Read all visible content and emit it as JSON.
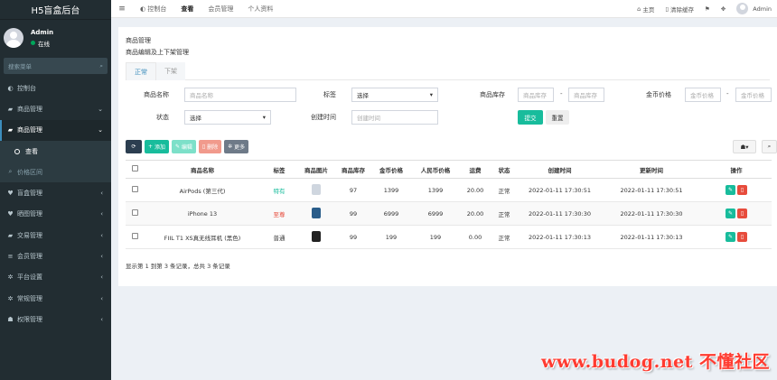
{
  "sidebar": {
    "brand": "H5盲盒后台",
    "user_name": "Admin",
    "user_status": "在线",
    "search_placeholder": "搜索菜单",
    "items": [
      {
        "icon": "dashboard-icon",
        "glyph": "◐",
        "label": "控制台",
        "arrow": ""
      },
      {
        "icon": "bag-icon",
        "glyph": "▰",
        "label": "商品管理",
        "arrow": "⌄"
      },
      {
        "icon": "bag-icon",
        "glyph": "▰",
        "label": "商品管理",
        "arrow": "⌄"
      },
      {
        "icon": "circle-icon",
        "glyph": "",
        "label": "查看",
        "arrow": ""
      },
      {
        "icon": "search-icon",
        "glyph": "⌕",
        "label": "价格区间",
        "arrow": ""
      },
      {
        "icon": "box-icon",
        "glyph": "♥",
        "label": "盲盒管理",
        "arrow": "‹"
      },
      {
        "icon": "box-icon",
        "glyph": "♥",
        "label": "晒图管理",
        "arrow": "‹"
      },
      {
        "icon": "trade-icon",
        "glyph": "▰",
        "label": "交易管理",
        "arrow": "‹"
      },
      {
        "icon": "member-icon",
        "glyph": "≡",
        "label": "会员管理",
        "arrow": "‹"
      },
      {
        "icon": "gears-icon",
        "glyph": "✲",
        "label": "平台设置",
        "arrow": "‹"
      },
      {
        "icon": "gears-icon",
        "glyph": "✲",
        "label": "常规管理",
        "arrow": "‹"
      },
      {
        "icon": "users-icon",
        "glyph": "☗",
        "label": "权限管理",
        "arrow": "‹"
      }
    ]
  },
  "topbar": {
    "tabs": [
      "控制台",
      "查看",
      "会员管理",
      "个人资料"
    ],
    "home": "主页",
    "clear_cache": "清除缓存",
    "user": "Admin"
  },
  "panel": {
    "title": "商品管理",
    "subtitle": "商品编辑及上下架管理",
    "tabs": [
      "正常",
      "下架"
    ]
  },
  "filter": {
    "name_label": "商品名称",
    "name_placeholder": "商品名称",
    "tag_label": "标签",
    "tag_value": "选择",
    "stock_label": "商品库存",
    "stock_placeholder": "商品库存",
    "coin_label": "金币价格",
    "coin_placeholder": "金币价格",
    "status_label": "状态",
    "status_value": "选择",
    "time_label": "创建时间",
    "time_placeholder": "创建时间",
    "submit": "提交",
    "reset": "重置",
    "dash": "-"
  },
  "toolbar": {
    "add": "添加",
    "edit": "编辑",
    "delete": "删除",
    "more": "更多"
  },
  "table": {
    "headers": [
      "商品名称",
      "标签",
      "商品图片",
      "商品库存",
      "金币价格",
      "人民币价格",
      "运费",
      "状态",
      "创建时间",
      "更新时间",
      "操作"
    ],
    "rows": [
      {
        "name": "AirPods (第三代)",
        "tag": "特有",
        "tag_class": "tag-hot",
        "thumb": "#cfd6df",
        "stock": "97",
        "coin": "1399",
        "rmb": "1399",
        "freight": "20.00",
        "status": "正常",
        "created": "2022-01-11 17:30:51",
        "updated": "2022-01-11 17:30:51"
      },
      {
        "name": "iPhone 13",
        "tag": "至尊",
        "tag_class": "tag-rare",
        "thumb": "#2a5d8a",
        "stock": "99",
        "coin": "6999",
        "rmb": "6999",
        "freight": "20.00",
        "status": "正常",
        "created": "2022-01-11 17:30:30",
        "updated": "2022-01-11 17:30:30"
      },
      {
        "name": "FIIL T1 XS真无线耳机 (黑色)",
        "tag": "普通",
        "tag_class": "tag-norm",
        "thumb": "#222222",
        "stock": "99",
        "coin": "199",
        "rmb": "199",
        "freight": "0.00",
        "status": "正常",
        "created": "2022-01-11 17:30:13",
        "updated": "2022-01-11 17:30:13"
      }
    ]
  },
  "summary": "显示第 1 到第 3 条记录，总共 3 条记录",
  "watermark": "www.budog.net 不懂社区",
  "colors": {
    "accent": "#18bc9c",
    "sidebar": "#222d32",
    "danger": "#e74c3c",
    "primary": "#3c8dbc"
  }
}
